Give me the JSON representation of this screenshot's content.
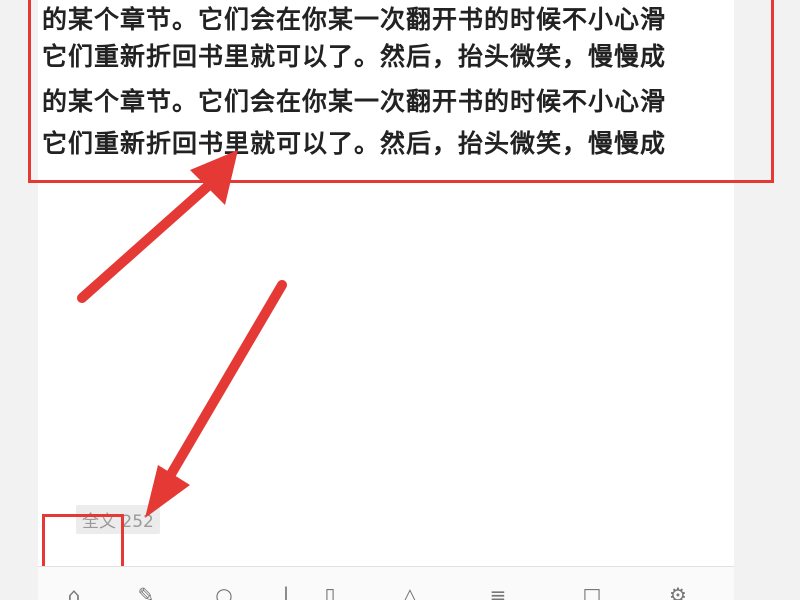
{
  "reader": {
    "lines": [
      "的某个章节。它们会在你某一次翻开书的时候不小心滑",
      "它们重新折回书里就可以了。然后，抬头微笑，慢慢成",
      "的某个章节。它们会在你某一次翻开书的时候不小心滑",
      "它们重新折回书里就可以了。然后，抬头微笑，慢慢成"
    ],
    "status_text": "全文 252"
  },
  "toolbar": {
    "icons": [
      "book-icon",
      "edit-icon",
      "search-icon",
      "separator-icon",
      "bookmark-icon",
      "triangle-icon",
      "menu-icon",
      "square-icon",
      "settings-icon"
    ]
  },
  "colors": {
    "annotation": "#e53935",
    "background": "#f2f2f2",
    "page": "#ffffff",
    "text": "#222222"
  }
}
